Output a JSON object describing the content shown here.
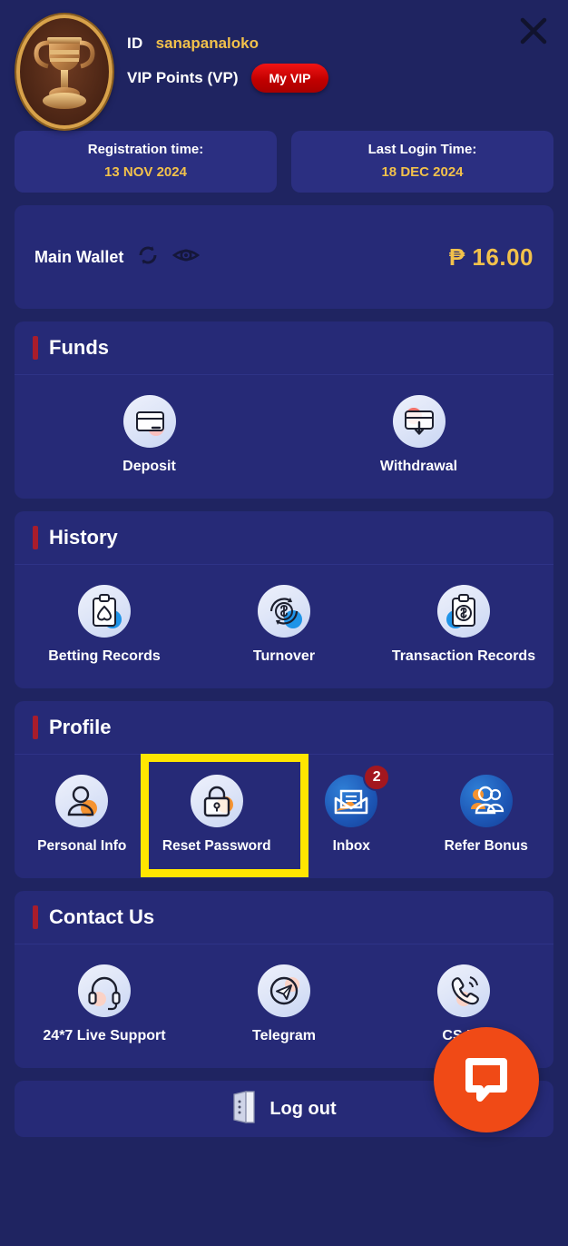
{
  "header": {
    "avatar_icon": "trophy-icon",
    "id_label": "ID",
    "id_value": "sanapanaloko",
    "vip_label": "VIP Points (VP)",
    "vip_button": "My VIP",
    "close_icon": "close-icon"
  },
  "chips": [
    {
      "title": "Registration time:",
      "value": "13 NOV 2024"
    },
    {
      "title": "Last Login Time:",
      "value": "18 DEC 2024"
    }
  ],
  "wallet": {
    "label": "Main Wallet",
    "refresh_icon": "refresh-icon",
    "eye_icon": "eye-icon",
    "amount": "₱ 16.00"
  },
  "sections": [
    {
      "title": "Funds",
      "items": [
        {
          "label": "Deposit",
          "icon": "deposit-card-icon"
        },
        {
          "label": "Withdrawal",
          "icon": "withdrawal-card-icon"
        }
      ]
    },
    {
      "title": "History",
      "items": [
        {
          "label": "Betting Records",
          "icon": "clipboard-spade-icon"
        },
        {
          "label": "Turnover",
          "icon": "refresh-dollar-icon"
        },
        {
          "label": "Transaction Records",
          "icon": "clipboard-dollar-icon"
        }
      ]
    },
    {
      "title": "Profile",
      "items": [
        {
          "label": "Personal Info",
          "icon": "user-icon"
        },
        {
          "label": "Reset Password",
          "icon": "lock-icon"
        },
        {
          "label": "Inbox",
          "icon": "envelope-icon",
          "badge": "2"
        },
        {
          "label": "Refer Bonus",
          "icon": "people-group-icon"
        }
      ]
    },
    {
      "title": "Contact Us",
      "items": [
        {
          "label": "24*7 Live Support",
          "icon": "headset-icon"
        },
        {
          "label": "Telegram",
          "icon": "telegram-icon"
        },
        {
          "label": "CS Ph",
          "icon": "phone-call-icon"
        }
      ]
    }
  ],
  "logout": {
    "label": "Log out",
    "icon": "door-icon"
  },
  "chat": {
    "icon": "chat-bubble-icon"
  },
  "colors": {
    "page_background": "#1f2461",
    "panel_background": "#262a77",
    "chip_background": "#2b2f81",
    "accent_bar": "#a81d2c",
    "gold_text": "#f2c14b",
    "vip_red": "#c20000",
    "badge_red": "#a3171f",
    "highlight_yellow": "#ffe600",
    "chat_orange": "#f04a16"
  }
}
